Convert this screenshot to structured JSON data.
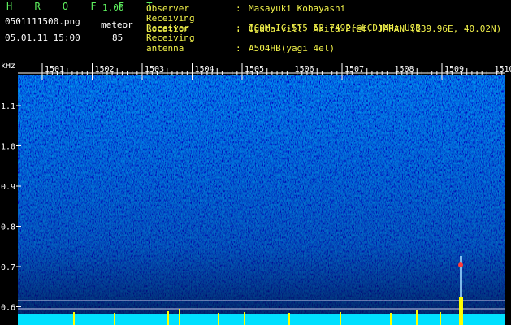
{
  "header": {
    "app_title": "H R O F F T",
    "app_version": "1.00",
    "file_name": "0501111500.png",
    "mode_label": "meteor",
    "timestamp": "05.01.11 15:00",
    "count_value": "85"
  },
  "info": [
    {
      "key": "Observer",
      "value": "Masayuki Kobayashi"
    },
    {
      "key": "Receiving Location",
      "value": "Ogata-vill. Akita-Pref. JAPAN (139.96E, 40.02N)"
    },
    {
      "key": "Receiver",
      "value": "ICOM IC-575 53.7492(@LCD)MHz USB"
    },
    {
      "key": "Receiving antenna",
      "value": "A504HB(yagi 4el)"
    }
  ],
  "axis": {
    "unit": "kHz",
    "y_ticks": [
      "1.1",
      "1.0",
      "0.9",
      "0.8",
      "0.7",
      "0.6"
    ],
    "x_ticks": [
      "1501",
      "1502",
      "1503",
      "1504",
      "1505",
      "1506",
      "1507",
      "1508",
      "1509",
      "1510"
    ]
  },
  "colors": {
    "background": "#000000",
    "spectrogram_base": "#0a1f8c",
    "signal": "#ffff00",
    "label_green": "#5ef05e",
    "label_yellow": "#f2f24a"
  }
}
